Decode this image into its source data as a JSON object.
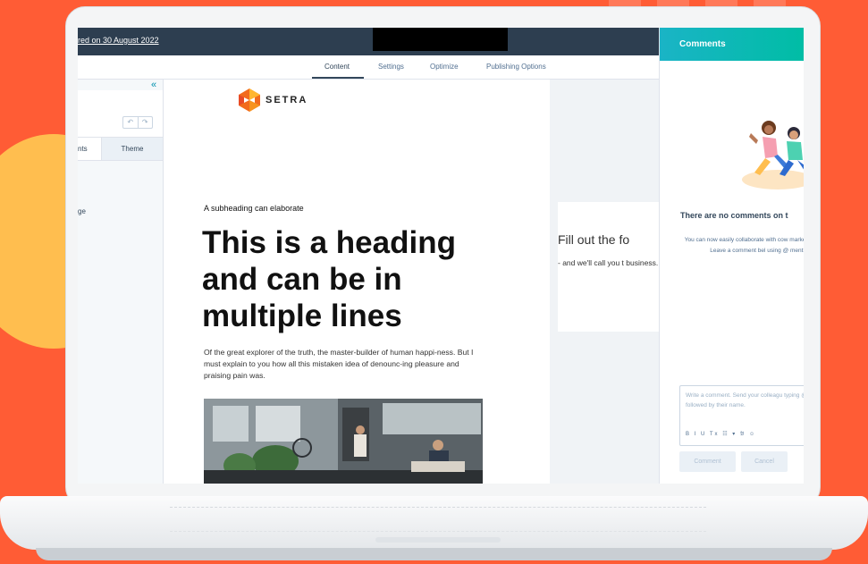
{
  "topbar": {
    "saved_text": "red on 30 August 2022"
  },
  "tabs": [
    {
      "label": "Content",
      "active": true
    },
    {
      "label": "Settings",
      "active": false
    },
    {
      "label": "Optimize",
      "active": false
    },
    {
      "label": "Publishing Options",
      "active": false
    }
  ],
  "sidebar": {
    "collapse_icon": "«",
    "undo_icon": "↶",
    "redo_icon": "↷",
    "subtab_modules": "nts",
    "subtab_theme": "Theme",
    "item_label": "ge"
  },
  "page": {
    "logo_text": "SETRA",
    "subheading": "A subheading can elaborate",
    "heading": "This is a heading and can be in multiple lines",
    "body": "Of the great explorer of the truth, the master-builder of human happi-ness. But I must explain to you how all this mistaken idea of denounc-ing pleasure and praising pain was."
  },
  "form": {
    "title": "Fill out the fo",
    "description": "- and we'll call you t business."
  },
  "comments": {
    "title": "Comments",
    "empty_title": "There are no comments on t",
    "collab_text": "You can now easily collaborate with cow marketing assets. Leave a comment bel using @ mentior",
    "placeholder": "Write a comment. Send your colleagu typing @ followed by their name.",
    "toolbar": "B I U Tx ☷ ▾ 𝔅 ☺",
    "comment_button": "Comment",
    "cancel_button": "Cancel"
  },
  "colors": {
    "background": "#ff5c35",
    "accent_circle": "#ffbe4f",
    "topbar": "#2d3e50",
    "comments_header": "#00bda5",
    "link": "#0091ae"
  }
}
